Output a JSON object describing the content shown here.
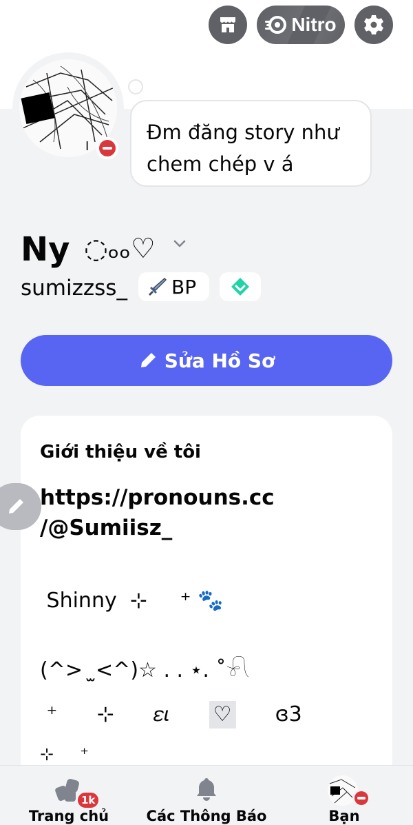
{
  "header": {
    "nitro_label": "Nitro",
    "icons": [
      "shop-icon",
      "nitro-icon",
      "gear-icon"
    ]
  },
  "profile": {
    "status_bubble": "Đm đăng story như chem chép v á",
    "display_name": "Ny",
    "display_name_deco": "◌ₒₒ♡",
    "username": "sumizzss_",
    "guild_tag": "BP",
    "status": "do-not-disturb"
  },
  "actions": {
    "edit_profile": "Sửa Hồ Sơ"
  },
  "about": {
    "title": "Giới thiệu về tôi",
    "link_line1": "https://pronouns.cc",
    "link_line2": "/@Sumiisz_",
    "line_shinny": " Shinny  ⊹     ⁺ 🐾",
    "line_kaomoji": "(^>  ̫<^)☆ . . ⋆. ˚𓍯",
    "line_deco_a": " ⁺      ⊹      𝜀𝜄      ",
    "line_heart": "♡",
    "line_deco_b": "      ɞ3",
    "line_deco_c": "⊹     ⁺"
  },
  "bottom_nav": {
    "home": "Trang chủ",
    "home_badge": "1k",
    "notifications": "Các Thông Báo",
    "you": "Bạn"
  },
  "colors": {
    "accent": "#5865f2",
    "dnd": "#da373c",
    "background": "#f2f3f5",
    "card": "#ffffff"
  }
}
